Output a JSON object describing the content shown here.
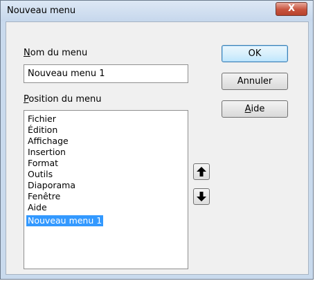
{
  "window": {
    "title": "Nouveau menu",
    "close_glyph": "X"
  },
  "form": {
    "name_label_accesskey": "N",
    "name_label_rest": "om du menu",
    "name_value": "Nouveau menu 1",
    "position_label_accesskey": "P",
    "position_label_rest": "osition du menu",
    "menu_items": [
      "Fichier",
      "Édition",
      "Affichage",
      "Insertion",
      "Format",
      "Outils",
      "Diaporama",
      "Fenêtre",
      "Aide",
      "Nouveau menu 1"
    ],
    "selected_index": 9
  },
  "buttons": {
    "ok": "OK",
    "cancel": "Annuler",
    "help_accesskey": "A",
    "help_rest": "ide"
  },
  "icons": {
    "move_up": "arrow-up-icon",
    "move_down": "arrow-down-icon",
    "close": "close-icon"
  },
  "colors": {
    "selection": "#3399ff",
    "close_button": "#c7533d"
  }
}
